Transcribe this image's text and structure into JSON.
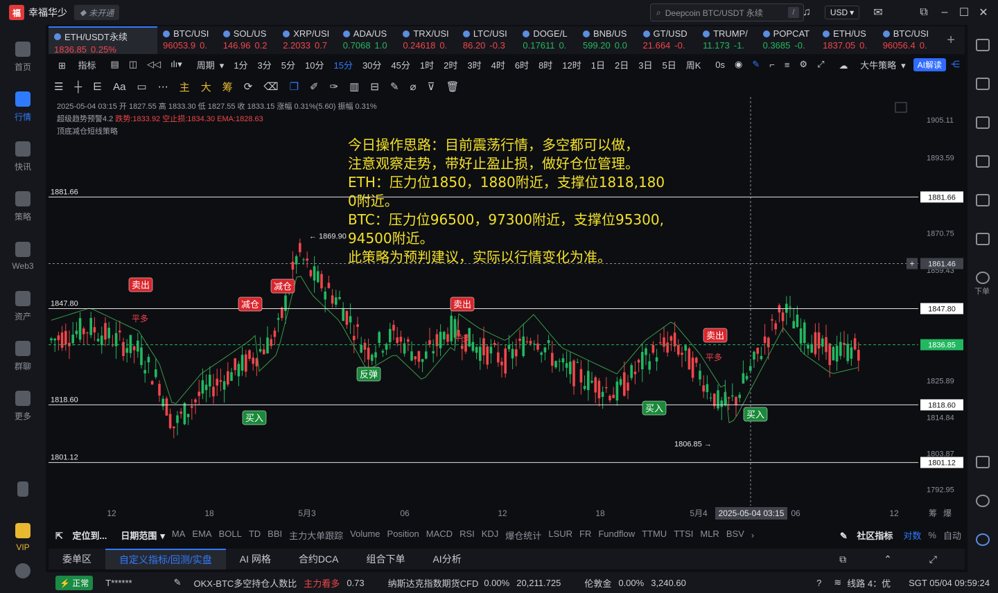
{
  "app": {
    "title": "幸福华少",
    "status_badge": "未开通"
  },
  "search": {
    "placeholder": "Deepcoin BTC/USDT 永续",
    "shortcut": "/"
  },
  "currency": "USD",
  "leftbar": [
    {
      "label": "首页"
    },
    {
      "label": "行情"
    },
    {
      "label": "快讯"
    },
    {
      "label": "策略"
    },
    {
      "label": "Web3"
    },
    {
      "label": "资产"
    },
    {
      "label": "群聊"
    },
    {
      "label": "更多"
    },
    {
      "label": "VIP"
    }
  ],
  "rightbar": {
    "order_label": "下单"
  },
  "symbols": [
    {
      "name": "ETH/USDT永续",
      "price": "1836.85",
      "change": "0.25%",
      "color": "red"
    },
    {
      "name": "BTC/USI",
      "price": "96053.9",
      "change": "0.",
      "color": "red"
    },
    {
      "name": "SOL/US",
      "price": "146.96",
      "change": "0.2",
      "color": "red"
    },
    {
      "name": "XRP/USI",
      "price": "2.2033",
      "change": "0.7",
      "color": "red"
    },
    {
      "name": "ADA/US",
      "price": "0.7068",
      "change": "1.0",
      "color": "green"
    },
    {
      "name": "TRX/USI",
      "price": "0.24618",
      "change": "0.",
      "color": "red"
    },
    {
      "name": "LTC/USI",
      "price": "86.20",
      "change": "-0.3",
      "color": "red"
    },
    {
      "name": "DOGE/L",
      "price": "0.17611",
      "change": "0.",
      "color": "green"
    },
    {
      "name": "BNB/US",
      "price": "599.20",
      "change": "0.0",
      "color": "green"
    },
    {
      "name": "GT/USD",
      "price": "21.664",
      "change": "-0.",
      "color": "red"
    },
    {
      "name": "TRUMP/",
      "price": "11.173",
      "change": "-1.",
      "color": "green"
    },
    {
      "name": "POPCAT",
      "price": "0.3685",
      "change": "-0.",
      "color": "green"
    },
    {
      "name": "ETH/US",
      "price": "1837.05",
      "change": "0.",
      "color": "red"
    },
    {
      "name": "BTC/USI",
      "price": "96056.4",
      "change": "0.",
      "color": "red"
    }
  ],
  "intervals": {
    "indicator_label": "指标",
    "period_label": "周期",
    "items": [
      "1分",
      "3分",
      "5分",
      "10分",
      "15分",
      "30分",
      "45分",
      "1时",
      "2时",
      "3时",
      "4时",
      "6时",
      "8时",
      "12时",
      "1日",
      "2日",
      "3日",
      "5日",
      "周K"
    ],
    "selected": "15分",
    "seconds_label": "0s",
    "strategy_label": "大牛策略",
    "ai_label": "AI解读"
  },
  "drawbar": {
    "main": "主",
    "big": "大",
    "chips": "筹"
  },
  "chart_info": {
    "ohlc": "2025-05-04 03:15  开 1827.55  高 1833.30  低 1827.55  收 1833.15  涨幅 0.31%(5.60)  振幅 0.31%",
    "indicator_name": "超级趋势预警4.2",
    "stop_loss_long": "跌势:1833.92",
    "stop_loss_short": "空止损:1834.30",
    "ema": "EMA:1828.63",
    "strategy_name": "顶底减仓短线策略"
  },
  "strategy_note": [
    "今日操作思路：目前震荡行情，多空都可以做，",
    "注意观察走势，带好止盈止损，做好仓位管理。",
    "ETH：压力位1850，1880附近，支撑位1818,1800附近。",
    "BTC：压力位96500，97300附近，支撑位95300,94500附近。",
    "此策略为预判建议，实际以行情变化为准。"
  ],
  "chart_data": {
    "type": "candlestick",
    "symbol": "ETH/USDT永续",
    "interval": "15分",
    "price_ticks": [
      "1905.11",
      "1893.59",
      "1870.75",
      "1859.43",
      "1825.89",
      "1814.84",
      "1803.87",
      "1792.95"
    ],
    "time_ticks": [
      "12",
      "18",
      "5月3",
      "06",
      "12",
      "18",
      "5月4",
      "06",
      "12"
    ],
    "crosshair_time": "2025-05-04 03:15",
    "crosshair_price": "1861.46",
    "current_price": "1836.85",
    "horizontal_lines": [
      {
        "price": 1881.66,
        "label": "1881.66"
      },
      {
        "price": 1847.8,
        "label": "1847.80"
      },
      {
        "price": 1818.6,
        "label": "1818.60"
      },
      {
        "price": 1801.12,
        "label": "1801.12"
      }
    ],
    "high_marker": "1869.90",
    "low_marker": "1806.85",
    "signals": [
      {
        "label": "卖出",
        "type": "sell"
      },
      {
        "label": "减仓",
        "type": "sell"
      },
      {
        "label": "减仓",
        "type": "sell"
      },
      {
        "label": "卖出",
        "type": "sell"
      },
      {
        "label": "卖出",
        "type": "sell"
      },
      {
        "label": "买入",
        "type": "buy"
      },
      {
        "label": "反弹",
        "type": "buy"
      },
      {
        "label": "买入",
        "type": "buy"
      },
      {
        "label": "买入",
        "type": "buy"
      }
    ],
    "trend_labels": [
      "平多",
      "平多",
      "平多"
    ],
    "ylim": [
      1788,
      1912
    ]
  },
  "indicator_bar": {
    "locate": "定位到...",
    "date_range": "日期范围",
    "items": [
      "MA",
      "EMA",
      "BOLL",
      "TD",
      "BBI",
      "主力大单跟踪",
      "Volume",
      "Position",
      "MACD",
      "RSI",
      "KDJ",
      "爆仓统计",
      "LSUR",
      "FR",
      "Fundflow",
      "TTMU",
      "TTSI",
      "MLR",
      "BSV"
    ],
    "community": "社区指标",
    "log": "对数",
    "percent": "%",
    "auto": "自动",
    "corner_labels": [
      "筹",
      "爆"
    ]
  },
  "panel_tabs": [
    "委单区",
    "自定义指标/回测/实盘",
    "AI 网格",
    "合约DCA",
    "组合下单",
    "AI分析"
  ],
  "statusbar": {
    "state": "正常",
    "user": "T******",
    "okx": "OKX-BTC多空持仓人数比",
    "okx_label": "主力看多",
    "okx_value": "0.73",
    "nasdaq": "纳斯达克指数期货CFD",
    "nasdaq_change": "0.00%",
    "nasdaq_value": "20,211.725",
    "gold": "伦敦金",
    "gold_change": "0.00%",
    "gold_value": "3,240.60",
    "line": "线路 4：优",
    "time": "SGT 05/04 09:59:24"
  }
}
